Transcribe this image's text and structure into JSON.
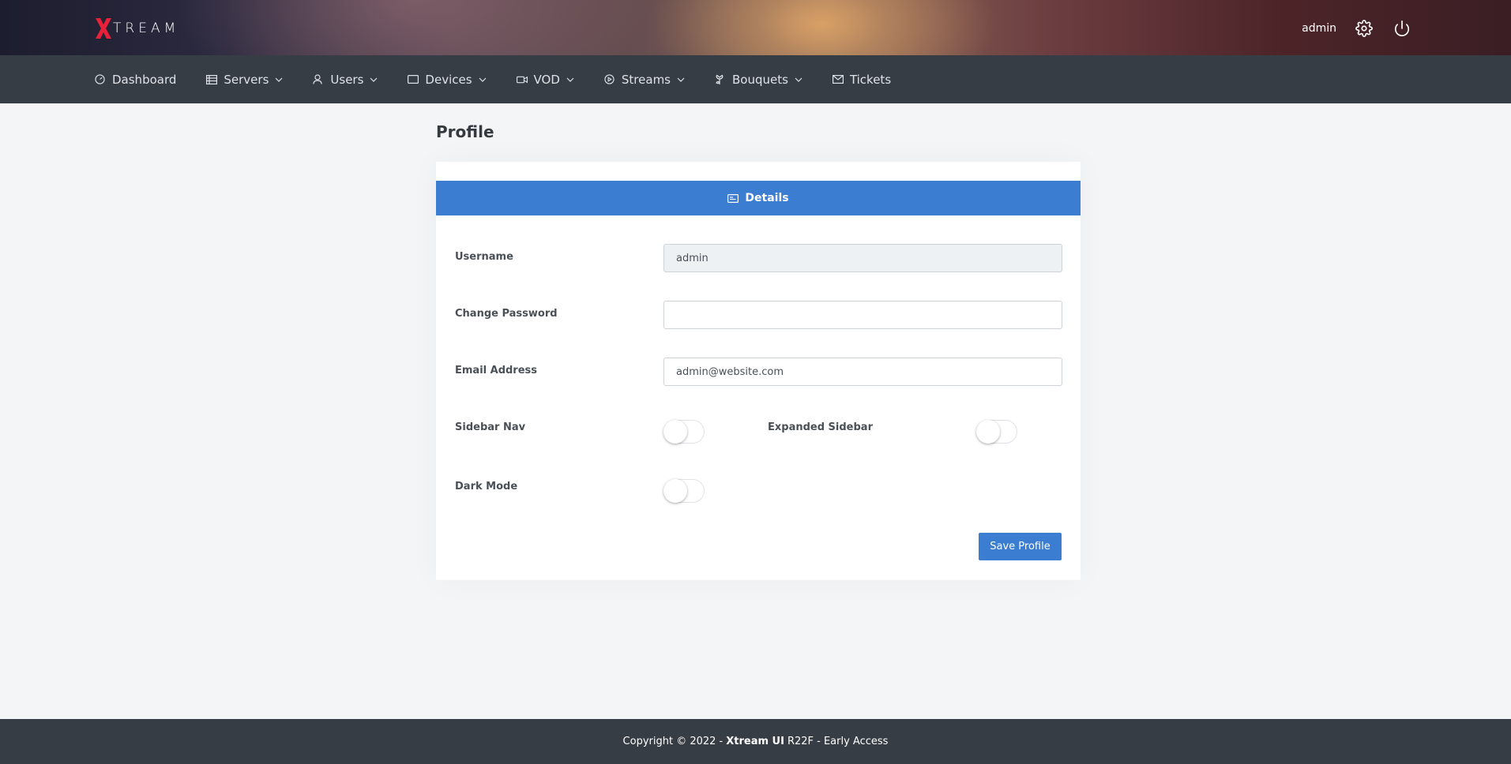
{
  "header": {
    "logo_text": "TREAM",
    "username": "admin",
    "icons": [
      "settings-gear-icon",
      "power-icon"
    ]
  },
  "nav": {
    "items": [
      {
        "label": "Dashboard",
        "icon": "gauge-icon",
        "dropdown": false
      },
      {
        "label": "Servers",
        "icon": "server-list-icon",
        "dropdown": true
      },
      {
        "label": "Users",
        "icon": "user-icon",
        "dropdown": true
      },
      {
        "label": "Devices",
        "icon": "tablet-icon",
        "dropdown": true
      },
      {
        "label": "VOD",
        "icon": "video-camera-icon",
        "dropdown": true
      },
      {
        "label": "Streams",
        "icon": "play-circle-icon",
        "dropdown": true
      },
      {
        "label": "Bouquets",
        "icon": "flower-icon",
        "dropdown": true
      },
      {
        "label": "Tickets",
        "icon": "envelope-icon",
        "dropdown": false
      }
    ]
  },
  "page": {
    "title": "Profile"
  },
  "card": {
    "tab_label": "Details",
    "fields": {
      "username": {
        "label": "Username",
        "value": "admin"
      },
      "password": {
        "label": "Change Password",
        "value": ""
      },
      "email": {
        "label": "Email Address",
        "value": "admin@website.com"
      }
    },
    "toggles": {
      "sidebar_nav": {
        "label": "Sidebar Nav",
        "on": false
      },
      "expanded_sidebar": {
        "label": "Expanded Sidebar",
        "on": false
      },
      "dark_mode": {
        "label": "Dark Mode",
        "on": false
      }
    },
    "save_label": "Save Profile"
  },
  "footer": {
    "prefix": "Copyright © 2022 -",
    "brand": "Xtream UI",
    "suffix": "R22F - Early Access"
  },
  "colors": {
    "accent": "#3a7dd1",
    "nav_bg": "#373d44",
    "logo_red": "#e8213a"
  }
}
